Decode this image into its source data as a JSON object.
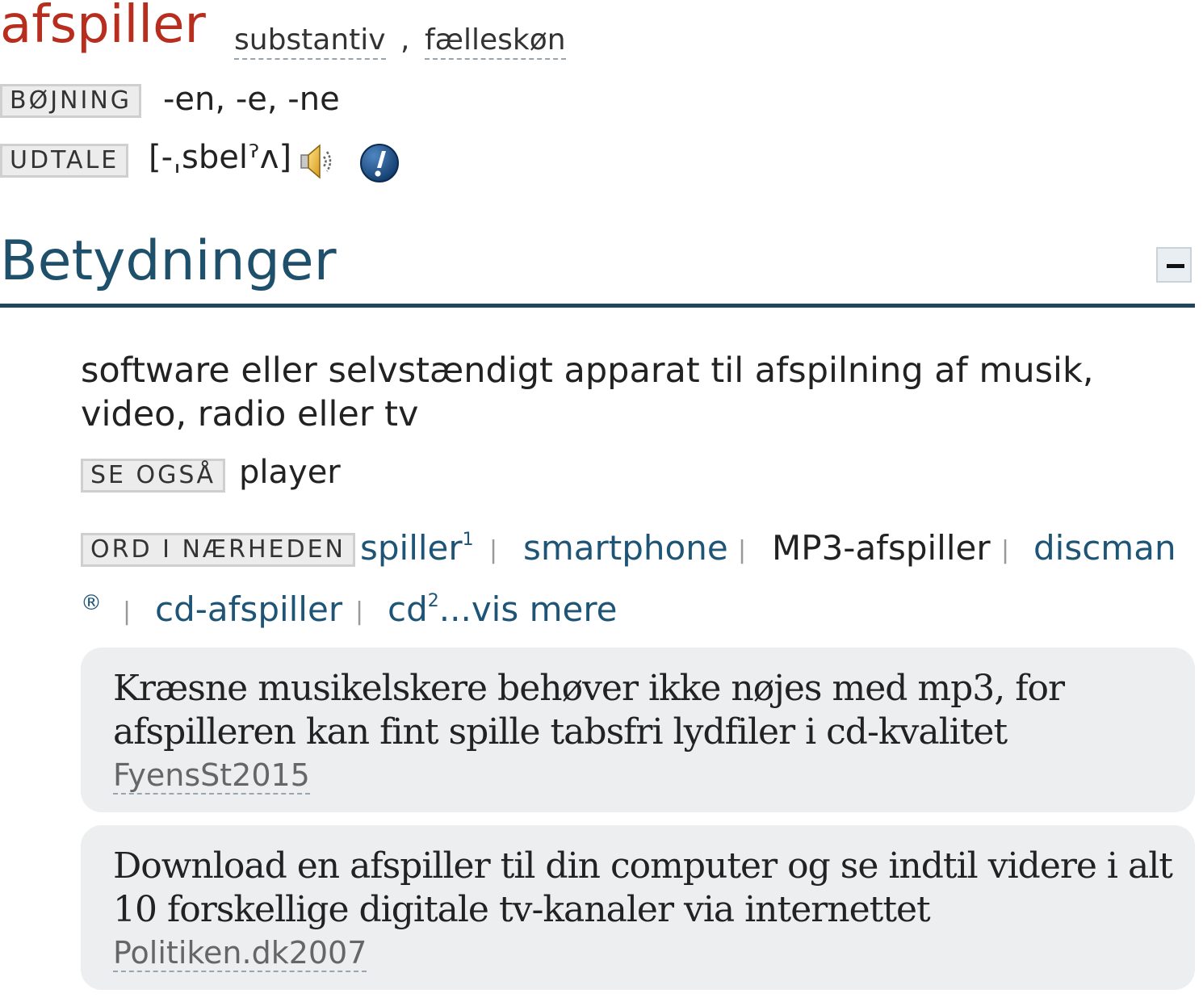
{
  "entry": {
    "headword": "afspiller",
    "word_class": "substantiv",
    "gender": "fælleskøn",
    "comma": ","
  },
  "inflection": {
    "label": "BØJNING",
    "value": "-en, -e, -ne"
  },
  "pronunciation": {
    "label": "UDTALE",
    "value": "[-ˌsbelˀʌ]",
    "speaker_icon": "speaker-icon",
    "info_icon": "info-icon"
  },
  "meanings": {
    "title": "Betydninger",
    "collapse_icon": "minus-icon",
    "definition": "software eller selvstændigt apparat til afspilning af musik, video, radio eller tv",
    "see_also": {
      "label": "SE OGSÅ",
      "value": "player"
    },
    "nearby": {
      "label": "ORD I NÆRHEDEN",
      "items": [
        {
          "text": "spiller",
          "sup": "1"
        },
        {
          "text": "smartphone",
          "sup": ""
        },
        {
          "text": "MP3-afspiller",
          "sup": ""
        },
        {
          "text": "discman",
          "sup": ""
        },
        {
          "text": "®",
          "sup": ""
        },
        {
          "text": "cd-afspiller",
          "sup": ""
        },
        {
          "text": "cd",
          "sup": "2"
        }
      ],
      "more_label": "...vis mere",
      "separator": "|"
    }
  },
  "examples": [
    {
      "text": "Kræsne musikelskere behøver ikke nøjes med mp3, for afspilleren kan fint spille tabsfri lydfiler i cd-kvalitet",
      "source": "FyensSt2015"
    },
    {
      "text": "Download en afspiller til din computer og se indtil videre i alt 10 forskellige digitale tv-kanaler via internettet",
      "source": "Politiken.dk2007"
    }
  ],
  "colors": {
    "headword": "#b82e1e",
    "section_title": "#1e4f6b",
    "link": "#1e5577",
    "example_bg": "#eceef0"
  }
}
